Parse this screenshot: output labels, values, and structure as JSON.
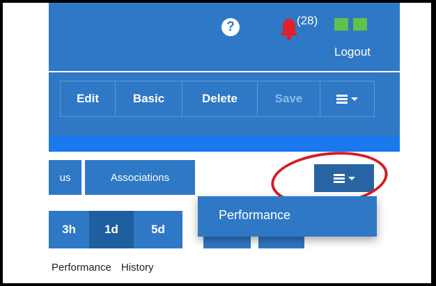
{
  "header": {
    "help_icon": "question-icon",
    "notification_icon": "bell-icon",
    "notification_count": "(28)",
    "logout_label": "Logout"
  },
  "toolbar": {
    "buttons": [
      "Edit",
      "Basic",
      "Delete",
      "Save"
    ],
    "menu_icon": "hamburger-icon"
  },
  "tabs": {
    "items": [
      "us",
      "Associations"
    ]
  },
  "more_menu": {
    "icon": "hamburger-icon",
    "items": [
      "Performance"
    ]
  },
  "time_ranges": [
    "3h",
    "1d",
    "5d"
  ],
  "selected_time_range": "1d",
  "subtabs": [
    "Performance",
    "History"
  ],
  "colors": {
    "primary": "#2f78c5",
    "selected": "#1f5fa0",
    "strip": "#1a78ee",
    "highlight_oval": "#d31c24",
    "status_green": "#5fc24a",
    "bell": "#e0202a"
  }
}
